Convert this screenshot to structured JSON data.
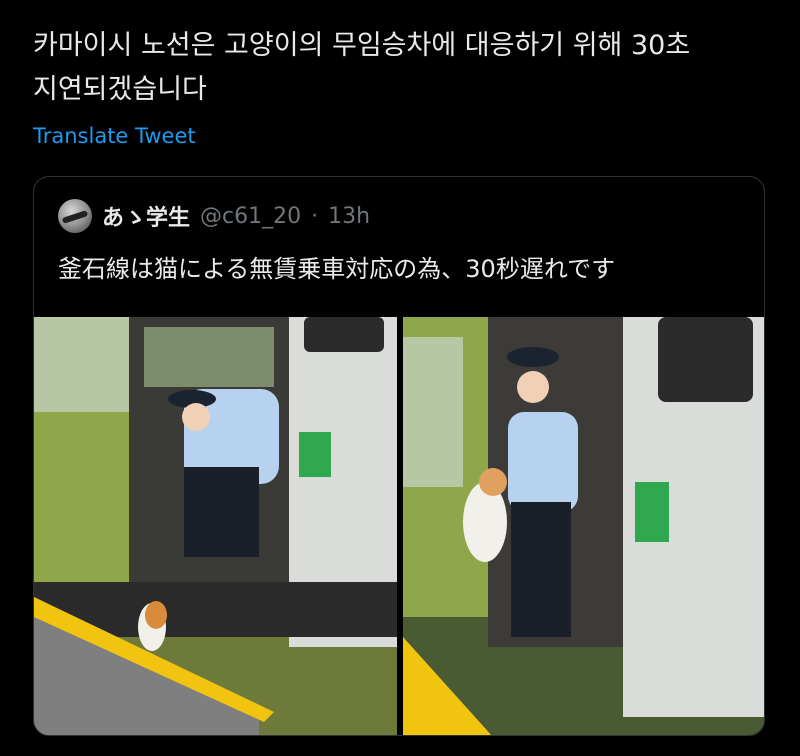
{
  "tweet": {
    "text": "카마이시 노선은 고양이의 무임승차에 대응하기 위해 30초\n지연되겠습니다",
    "translate_label": "Translate Tweet"
  },
  "quoted_tweet": {
    "author_name": "あゝ学生",
    "handle": "@c61_20",
    "separator": "·",
    "time": "13h",
    "text": "釜石線は猫による無賃乗車対応の為、30秒遅れです",
    "photos": [
      {
        "icon": "photo-conductor-reaching-cat"
      },
      {
        "icon": "photo-conductor-carrying-cat"
      }
    ]
  },
  "colors": {
    "background": "#000000",
    "text": "#e7e9ea",
    "link": "#1d9bf0",
    "muted": "#71767b",
    "border": "#2f3336",
    "train_green": "#8fa74a",
    "platform_yellow": "#f1c40f"
  }
}
